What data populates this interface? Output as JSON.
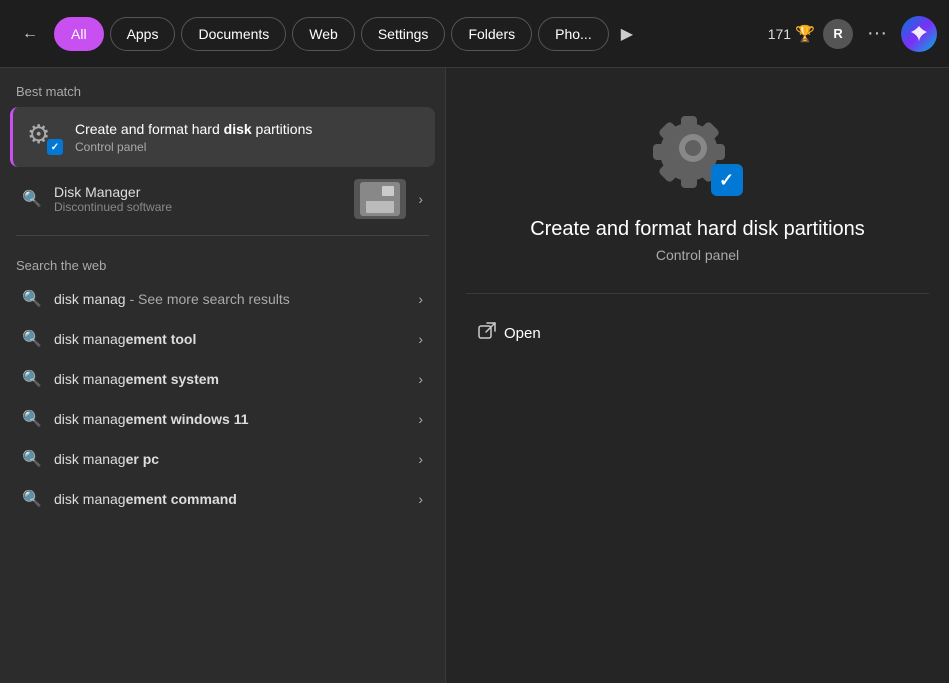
{
  "topbar": {
    "back_label": "←",
    "pills": [
      {
        "label": "All",
        "active": true
      },
      {
        "label": "Apps",
        "active": false
      },
      {
        "label": "Documents",
        "active": false
      },
      {
        "label": "Web",
        "active": false
      },
      {
        "label": "Settings",
        "active": false
      },
      {
        "label": "Folders",
        "active": false
      },
      {
        "label": "Pho...",
        "active": false
      }
    ],
    "score": "171",
    "trophy_icon": "🏆",
    "user_initial": "R",
    "more_icon": "···",
    "copilot_icon": "✦"
  },
  "left": {
    "best_match_label": "Best match",
    "best_match": {
      "title_prefix": "Create and format hard ",
      "title_bold": "disk",
      "title_suffix": " partitions",
      "subtitle": "Control panel"
    },
    "disk_manager": {
      "title": "Disk Manager",
      "subtitle": "Discontinued software"
    },
    "web_search_label": "Search the web",
    "web_items": [
      {
        "prefix": "disk manag",
        "bold": "",
        "suffix": " - See more search results"
      },
      {
        "prefix": "disk manag",
        "bold": "ement tool",
        "suffix": ""
      },
      {
        "prefix": "disk manag",
        "bold": "ement system",
        "suffix": ""
      },
      {
        "prefix": "disk manag",
        "bold": "ement windows 11",
        "suffix": ""
      },
      {
        "prefix": "disk manag",
        "bold": "er pc",
        "suffix": ""
      },
      {
        "prefix": "disk manag",
        "bold": "ement command",
        "suffix": ""
      }
    ]
  },
  "right": {
    "title": "Create and format hard disk partitions",
    "subtitle": "Control panel",
    "open_label": "Open",
    "open_icon": "⬡"
  }
}
